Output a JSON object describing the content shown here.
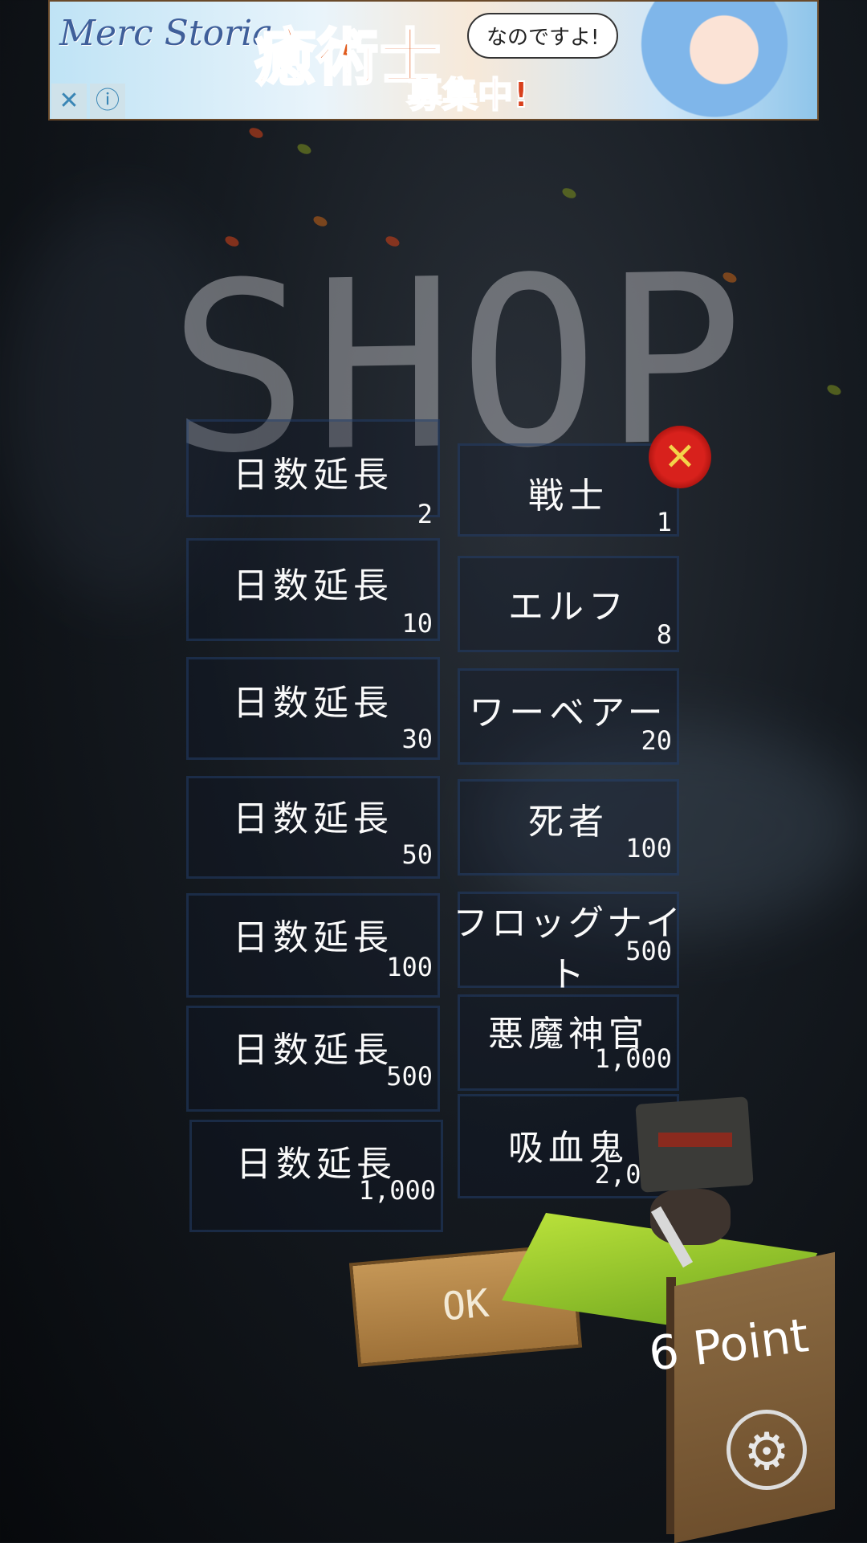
{
  "ad": {
    "logo": "Merc Storia",
    "headline": "癒術士",
    "subheadline": "募集中!",
    "bubble": "なのですよ!",
    "close": "✕",
    "info": "ⓘ"
  },
  "title": "SHOP",
  "close_icon": "close-icon",
  "close_symbol": "✕",
  "rows": [
    {
      "left": {
        "label": "日数延長",
        "price": "2"
      },
      "right": {
        "label": "戦士",
        "price": "1"
      }
    },
    {
      "left": {
        "label": "日数延長",
        "price": "10"
      },
      "right": {
        "label": "エルフ",
        "price": "8"
      }
    },
    {
      "left": {
        "label": "日数延長",
        "price": "30"
      },
      "right": {
        "label": "ワーベアー",
        "price": "20"
      }
    },
    {
      "left": {
        "label": "日数延長",
        "price": "50"
      },
      "right": {
        "label": "死者",
        "price": "100"
      }
    },
    {
      "left": {
        "label": "日数延長",
        "price": "100"
      },
      "right": {
        "label": "フロッグナイト",
        "price": "500"
      }
    },
    {
      "left": {
        "label": "日数延長",
        "price": "500"
      },
      "right": {
        "label": "悪魔神官",
        "price": "1,000"
      }
    },
    {
      "left": {
        "label": "日数延長",
        "price": "1,000"
      },
      "right": {
        "label": "吸血鬼",
        "price": "2,000"
      }
    }
  ],
  "ok_label": "OK",
  "points": "6 Point",
  "gear_symbol": "⚙",
  "colors": {
    "accent_red": "#d8211c",
    "button_wood": "#c49656",
    "grass": "#9ccc2a"
  }
}
